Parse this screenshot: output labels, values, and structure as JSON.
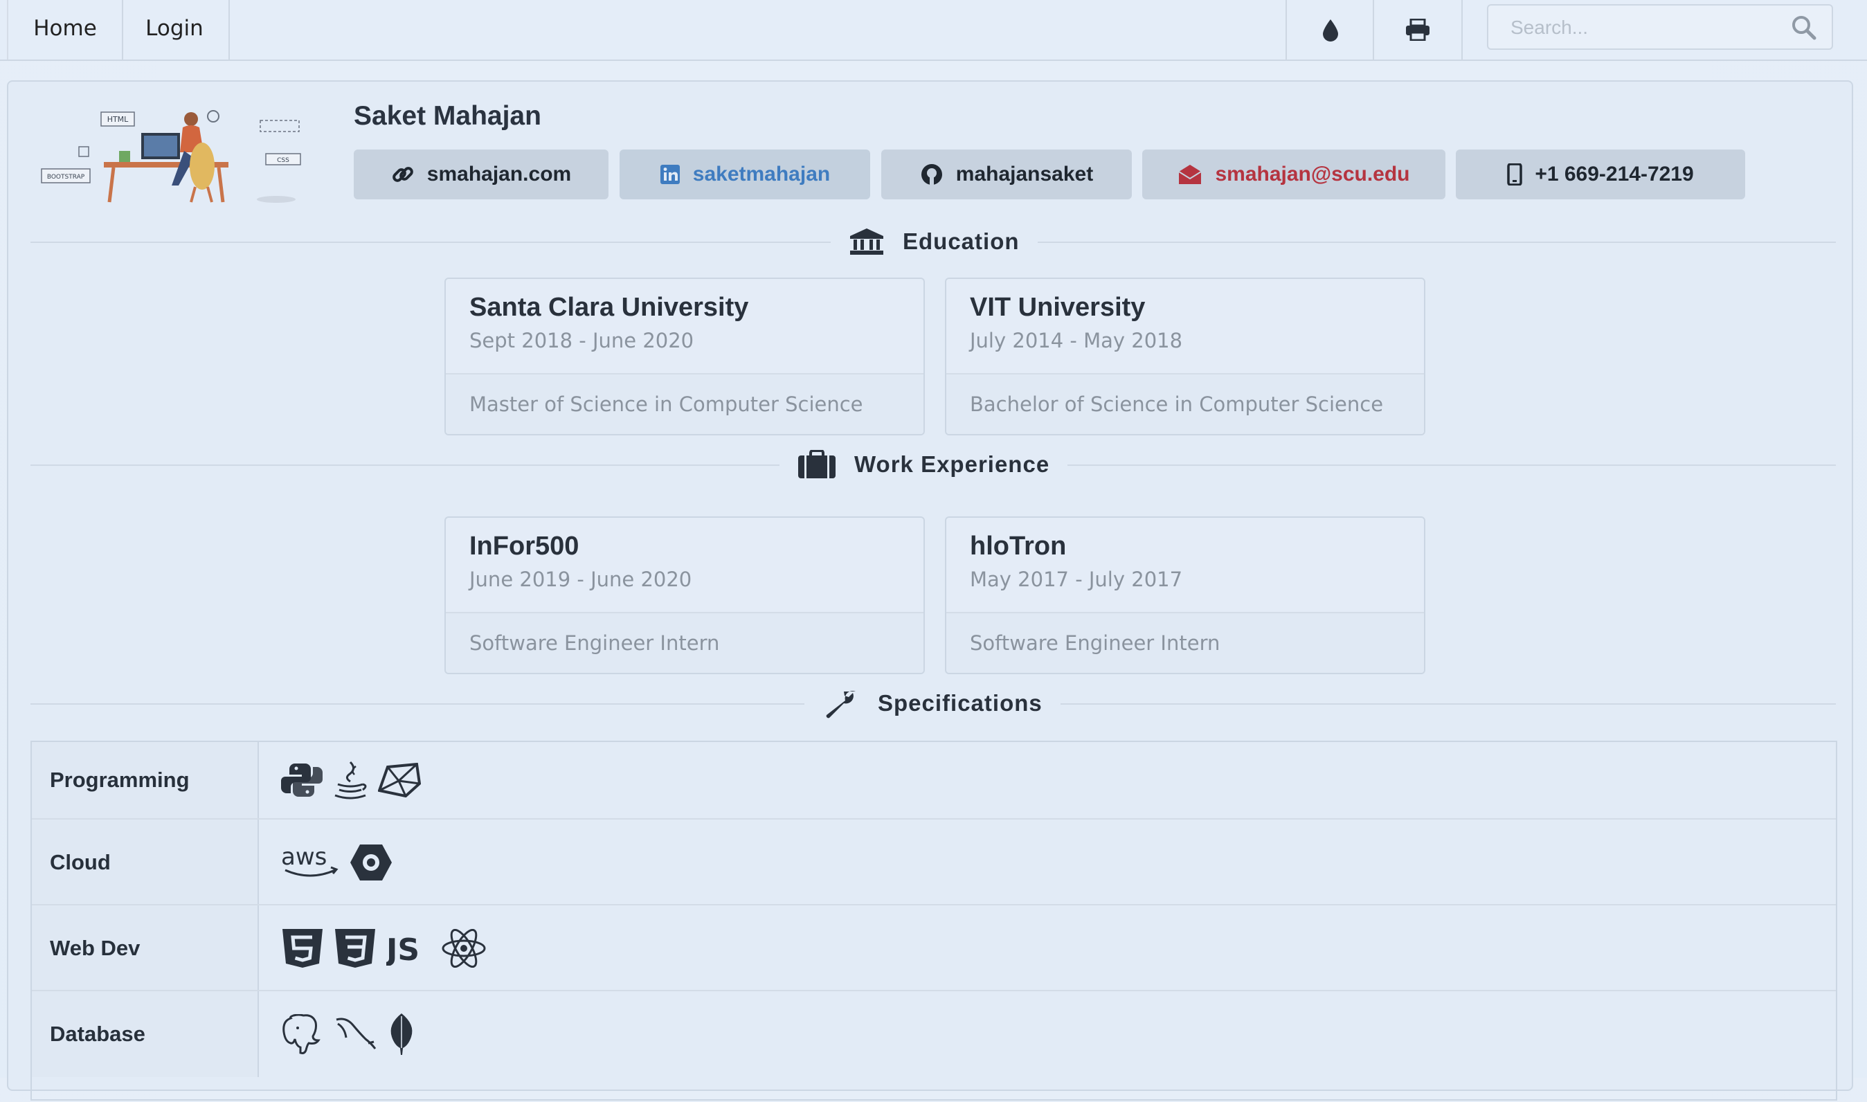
{
  "nav": {
    "home": "Home",
    "login": "Login",
    "search_placeholder": "Search...",
    "icons": [
      "tint-icon",
      "print-icon",
      "search-icon"
    ]
  },
  "profile": {
    "name": "Saket Mahajan",
    "links": {
      "website": "smahajan.com",
      "linkedin": "saketmahajan",
      "github": "mahajansaket",
      "email": "smahajan@scu.edu",
      "phone": "+1 669-214-7219"
    },
    "hero_labels": [
      "HTML",
      "BOOTSTRAP",
      "CSS"
    ]
  },
  "sections": {
    "education": "Education",
    "work": "Work Experience",
    "specs": "Specifications"
  },
  "education": [
    {
      "school": "Santa Clara University",
      "dates": "Sept 2018 - June 2020",
      "degree": "Master of Science in Computer Science"
    },
    {
      "school": "VIT University",
      "dates": "July 2014 - May 2018",
      "degree": "Bachelor of Science in Computer Science"
    }
  ],
  "work": [
    {
      "company": "InFor500",
      "dates": "June 2019 - June 2020",
      "role": "Software Engineer Intern"
    },
    {
      "company": "hloTron",
      "dates": "May 2017 - July 2017",
      "role": "Software Engineer Intern"
    }
  ],
  "specs": [
    {
      "label": "Programming",
      "icons": [
        "python-icon",
        "java-icon",
        "ruby-icon"
      ]
    },
    {
      "label": "Cloud",
      "icons": [
        "aws-icon",
        "gcp-icon"
      ]
    },
    {
      "label": "Web Dev",
      "icons": [
        "html5-icon",
        "css3-icon",
        "js-icon",
        "react-icon"
      ]
    },
    {
      "label": "Database",
      "icons": [
        "postgresql-icon",
        "mysql-icon",
        "mongodb-icon"
      ]
    }
  ],
  "colors": {
    "background": "#e3edf8",
    "pill": "#c7d2df",
    "linkedin": "#3f7cc0",
    "email": "#b53440",
    "text": "#2b3440"
  }
}
